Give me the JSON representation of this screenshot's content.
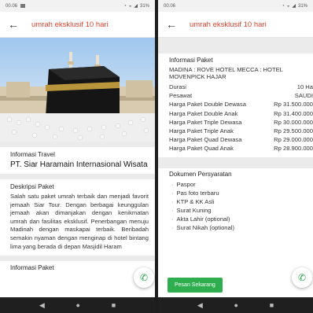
{
  "left": {
    "status_time": "00.06",
    "status_battery": "31%",
    "app_title": "umrah eksklusif 10 hari",
    "travel_label": "Informasi Travel",
    "travel_name": "PT. Siar Haramain Internasional Wisata",
    "desc_label": "Deskripsi Paket",
    "desc_text": "Salah satu paket umrah terbaik dan menjadi favorit jemaah Siar Tour. Dengan berbagai keunggulan jemaah akan dimanjakan dengan kenikmatan umrah dan fasilitas eksklusif. Penerbangan menuju Madinah dengan maskapai terbaik. Beribadah semakin nyaman dengan menginap di hotel bintang lima yang berada di depan Masjidil Haram",
    "next_label": "Informasi Paket"
  },
  "right": {
    "status_time": "00.06",
    "status_battery": "31%",
    "app_title": "umrah eksklusif 10 hari",
    "info_label": "Informasi Paket",
    "hotel_text": "MADINA : ROVE HOTEL MECCA : HOTEL MOVENPICK HAJAR",
    "rows": [
      {
        "label": "Durasi",
        "value": "10 Ha"
      },
      {
        "label": "Pesawat",
        "value": "SAUDI"
      },
      {
        "label": "Harga Paket Double Dewasa",
        "value": "Rp 31.500.000"
      },
      {
        "label": "Harga Paket Double Anak",
        "value": "Rp 31.400.000"
      },
      {
        "label": "Harga Paket Triple Dewasa",
        "value": "Rp 30.000.000"
      },
      {
        "label": "Harga Paket Triple Anak",
        "value": "Rp 29.500.000"
      },
      {
        "label": "Harga Paket Quad Dewasa",
        "value": "Rp 29.000.000"
      },
      {
        "label": "Harga Paket Quad Anak",
        "value": "Rp 28.900.000"
      }
    ],
    "doc_label": "Dokumen Persyaratan",
    "docs": [
      "Paspor",
      "Pas foto terbaru",
      "KTP & KK Asli",
      "Surat Kuning",
      "Akta Lahir (optional)",
      "Surat Nikah (optional)"
    ],
    "order_button": "Pesan Sekarang"
  },
  "icons": {
    "back": "arrow-left-icon",
    "phone": "phone-icon",
    "nav_back": "triangle-back-icon",
    "nav_home": "circle-home-icon",
    "nav_recent": "square-recent-icon"
  },
  "colors": {
    "accent": "#e0422f",
    "call_green": "#26a24a",
    "order_green": "#2fae4f"
  }
}
